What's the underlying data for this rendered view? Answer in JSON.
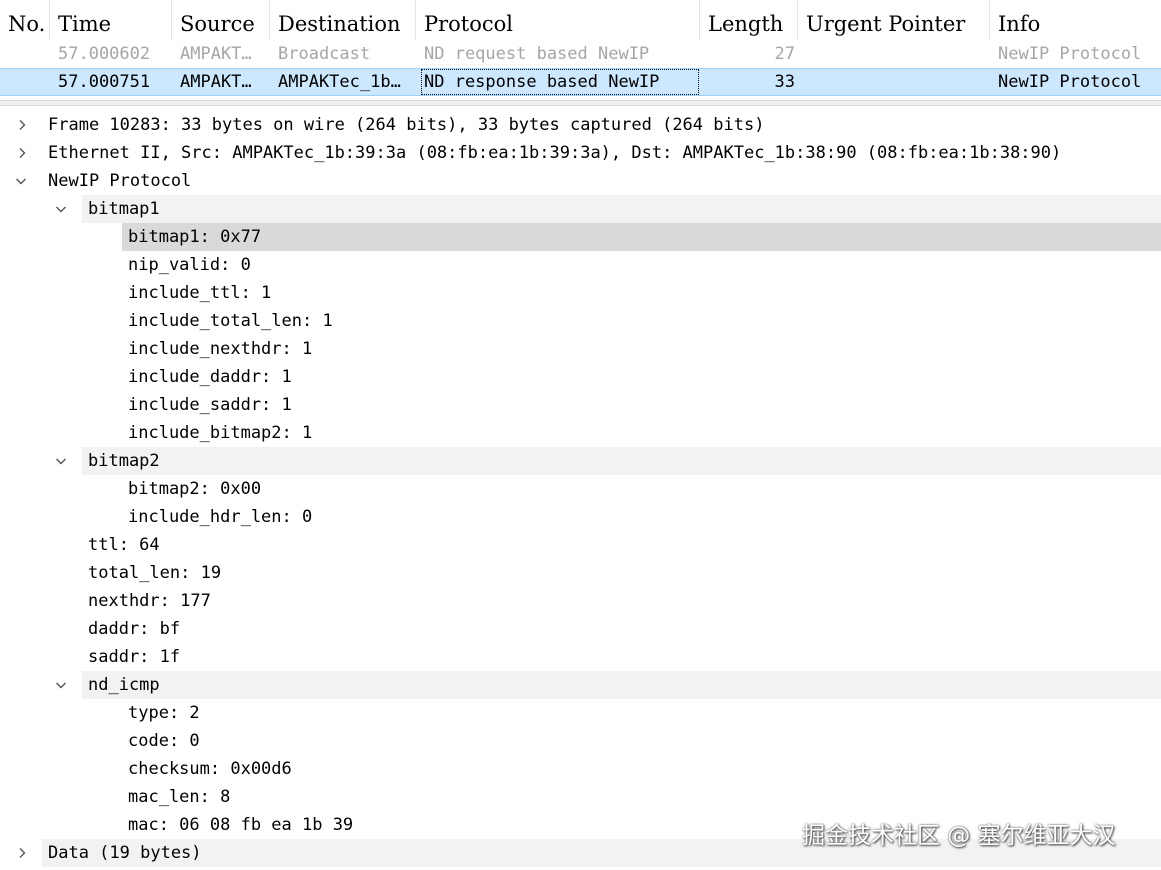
{
  "packet_list": {
    "columns": [
      "No.",
      "Time",
      "Source",
      "Destination",
      "Protocol",
      "Length",
      "Urgent Pointer",
      "Info"
    ],
    "rows": [
      {
        "time": "57.000602",
        "source": "AMPAKT…",
        "destination": "Broadcast",
        "protocol": "ND request based NewIP",
        "length": "27",
        "urgent_pointer": "",
        "info": "NewIP Protocol"
      },
      {
        "time": "57.000751",
        "source": "AMPAKT…",
        "destination": "AMPAKTec_1b…",
        "protocol": "ND response based NewIP",
        "length": "33",
        "urgent_pointer": "",
        "info": "NewIP Protocol"
      }
    ]
  },
  "details": {
    "frame": "Frame 10283: 33 bytes on wire (264 bits), 33 bytes captured (264 bits)",
    "ethernet": "Ethernet II, Src: AMPAKTec_1b:39:3a (08:fb:ea:1b:39:3a), Dst: AMPAKTec_1b:38:90 (08:fb:ea:1b:38:90)",
    "newip": "NewIP Protocol",
    "bitmap1_group": "bitmap1",
    "bitmap1_fields": [
      "bitmap1: 0x77",
      "nip_valid: 0",
      "include_ttl: 1",
      "include_total_len: 1",
      "include_nexthdr: 1",
      "include_daddr: 1",
      "include_saddr: 1",
      "include_bitmap2: 1"
    ],
    "bitmap2_group": "bitmap2",
    "bitmap2_fields": [
      "bitmap2: 0x00",
      "include_hdr_len: 0"
    ],
    "header_fields": [
      "ttl: 64",
      "total_len: 19",
      "nexthdr: 177",
      "daddr: bf",
      "saddr: 1f"
    ],
    "nd_icmp_group": "nd_icmp",
    "nd_icmp_fields": [
      "type: 2",
      "code: 0",
      "checksum: 0x00d6",
      "mac_len: 8",
      "mac: 06 08 fb ea 1b 39"
    ],
    "data": "Data (19 bytes)"
  },
  "watermark": "掘金技术社区 @ 塞尔维亚大汉",
  "colors": {
    "selected_row": "#cce8ff",
    "highlighted_field": "#d9d9d9",
    "zebra": "#f2f2f2",
    "dim_text": "#a6a6a6"
  }
}
